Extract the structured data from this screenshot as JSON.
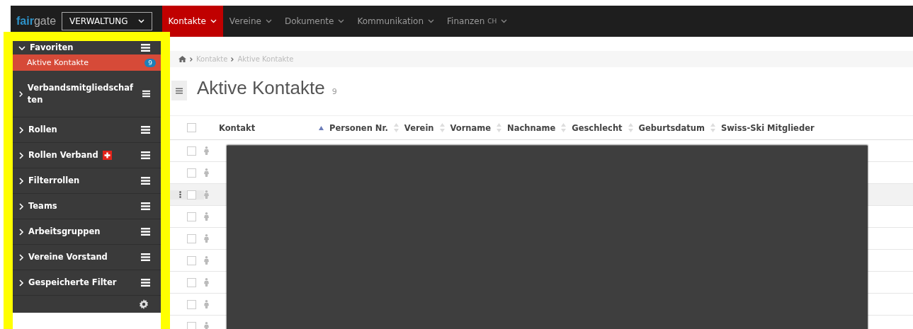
{
  "logo": {
    "first": "fair",
    "second": "gate"
  },
  "area_dropdown": "VERWALTUNG",
  "nav": [
    {
      "label": "Kontakte",
      "selected": true
    },
    {
      "label": "Vereine",
      "selected": false
    },
    {
      "label": "Dokumente",
      "selected": false
    },
    {
      "label": "Kommunikation",
      "selected": false
    },
    {
      "label": "Finanzen",
      "suffix": "CH",
      "selected": false
    }
  ],
  "sidebar": {
    "sections": [
      {
        "label": "Favoriten",
        "expanded": true,
        "items": [
          {
            "label": "Aktive Kontakte",
            "count": "9",
            "selected": true
          }
        ]
      },
      {
        "label": "Verbandsmitgliedschaften",
        "expanded": false
      },
      {
        "label": "Rollen",
        "expanded": false
      },
      {
        "label": "Rollen Verband",
        "expanded": false,
        "flag": true
      },
      {
        "label": "Filterrollen",
        "expanded": false
      },
      {
        "label": "Teams",
        "expanded": false
      },
      {
        "label": "Arbeitsgruppen",
        "expanded": false
      },
      {
        "label": "Vereine Vorstand",
        "expanded": false
      },
      {
        "label": "Gespeicherte Filter",
        "expanded": false
      }
    ]
  },
  "breadcrumb": [
    "Kontakte",
    "Aktive Kontakte"
  ],
  "page_title": "Aktive Kontakte",
  "page_count": "9",
  "table": {
    "columns": [
      {
        "label": "Kontakt",
        "sorted": true
      },
      {
        "label": "Personen Nr.",
        "sortable": true,
        "sorted": false
      },
      {
        "label": "Verein",
        "sortable": true,
        "sorted": false
      },
      {
        "label": "Vorname",
        "sortable": true,
        "sorted": false
      },
      {
        "label": "Nachname",
        "sortable": true,
        "sorted": false
      },
      {
        "label": "Geschlecht",
        "sortable": true,
        "sorted": false
      },
      {
        "label": "Geburtsdatum",
        "sortable": true,
        "sorted": false
      },
      {
        "label": "Swiss-Ski Mitglieder",
        "sortable": false,
        "sorted": false
      }
    ],
    "select_all_checked": false,
    "rows": [
      {
        "checked": false,
        "highlighted": false
      },
      {
        "checked": false,
        "highlighted": false
      },
      {
        "checked": false,
        "highlighted": true
      },
      {
        "checked": false,
        "highlighted": false
      },
      {
        "checked": false,
        "highlighted": false
      },
      {
        "checked": false,
        "highlighted": false
      },
      {
        "checked": false,
        "highlighted": false
      },
      {
        "checked": false,
        "highlighted": false
      },
      {
        "checked": false,
        "highlighted": false
      }
    ]
  },
  "highlight_frame": true
}
